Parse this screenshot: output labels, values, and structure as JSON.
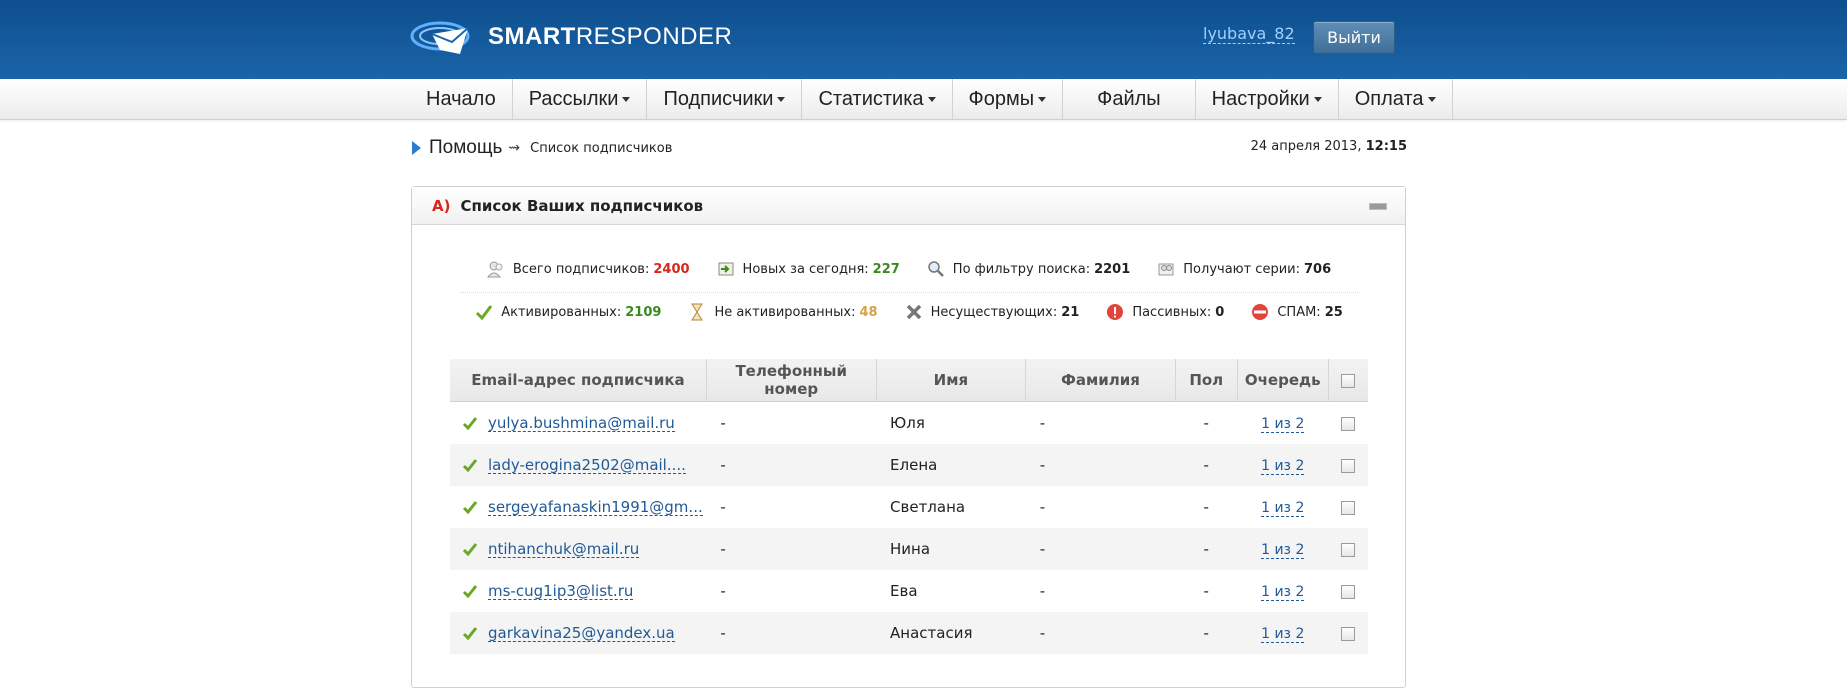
{
  "header": {
    "logo_bold": "SMART",
    "logo_light": "RESPONDER",
    "username": "lyubava_82",
    "logout_label": "Выйти"
  },
  "nav": {
    "items": [
      {
        "label": "Начало"
      },
      {
        "label": "Рассылки"
      },
      {
        "label": "Подписчики"
      },
      {
        "label": "Статистика"
      },
      {
        "label": "Формы"
      },
      {
        "label": "Файлы"
      },
      {
        "label": "Настройки"
      },
      {
        "label": "Оплата"
      }
    ]
  },
  "breadcrumb": {
    "help": "Помощь",
    "page": "Список подписчиков"
  },
  "datetime": {
    "date": "24 апреля 2013,",
    "time": "12:15"
  },
  "panel": {
    "letter": "A)",
    "title": "Список Ваших подписчиков"
  },
  "stats": {
    "total_label": "Всего подписчиков:",
    "total_value": "2400",
    "new_label": "Новых за сегодня:",
    "new_value": "227",
    "filter_label": "По фильтру поиска:",
    "filter_value": "2201",
    "series_label": "Получают серии:",
    "series_value": "706",
    "active_label": "Активированных:",
    "active_value": "2109",
    "inactive_label": "Не активированных:",
    "inactive_value": "48",
    "nonexist_label": "Несуществующих:",
    "nonexist_value": "21",
    "passive_label": "Пассивных:",
    "passive_value": "0",
    "spam_label": "СПАМ:",
    "spam_value": "25"
  },
  "colors": {
    "total": "#d9261c",
    "new": "#3a8a1f",
    "active": "#3a8a1f",
    "inactive": "#d8a04a"
  },
  "table": {
    "headers": {
      "email": "Email-адрес подписчика",
      "phone": "Телефонный номер",
      "name": "Имя",
      "surname": "Фамилия",
      "gender": "Пол",
      "queue": "Очередь"
    },
    "rows": [
      {
        "email": "yulya.bushmina@mail.ru",
        "phone": "-",
        "name": "Юля",
        "surname": "-",
        "gender": "-",
        "queue": "1 из 2"
      },
      {
        "email": "lady-erogina2502@mail....",
        "phone": "-",
        "name": "Елена",
        "surname": "-",
        "gender": "-",
        "queue": "1 из 2"
      },
      {
        "email": "sergeyafanaskin1991@gm...",
        "phone": "-",
        "name": "Светлана",
        "surname": "-",
        "gender": "-",
        "queue": "1 из 2"
      },
      {
        "email": "ntihanchuk@mail.ru",
        "phone": "-",
        "name": "Нина",
        "surname": "-",
        "gender": "-",
        "queue": "1 из 2"
      },
      {
        "email": "ms-cug1ip3@list.ru",
        "phone": "-",
        "name": "Ева",
        "surname": "-",
        "gender": "-",
        "queue": "1 из 2"
      },
      {
        "email": "garkavina25@yandex.ua",
        "phone": "-",
        "name": "Анастасия",
        "surname": "-",
        "gender": "-",
        "queue": "1 из 2"
      }
    ]
  }
}
